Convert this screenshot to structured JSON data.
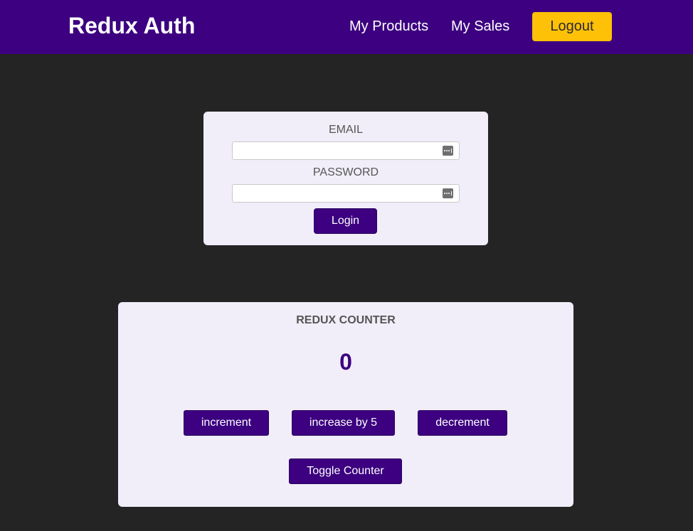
{
  "header": {
    "title": "Redux Auth",
    "nav": {
      "products": "My Products",
      "sales": "My Sales"
    },
    "logout_label": "Logout"
  },
  "login": {
    "email_label": "EMAIL",
    "email_value": "",
    "password_label": "PASSWORD",
    "password_value": "",
    "autofill_icon": "password-manager-key-icon",
    "submit_label": "Login"
  },
  "counter": {
    "title": "REDUX COUNTER",
    "value": "0",
    "buttons": {
      "increment": "increment",
      "increase": "increase by 5",
      "decrement": "decrement",
      "toggle": "Toggle Counter"
    }
  },
  "colors": {
    "header_bg": "#3c0080",
    "page_bg": "#242424",
    "card_bg": "#f1eef9",
    "accent_button": "#ffc107",
    "primary_button": "#3c0080"
  }
}
